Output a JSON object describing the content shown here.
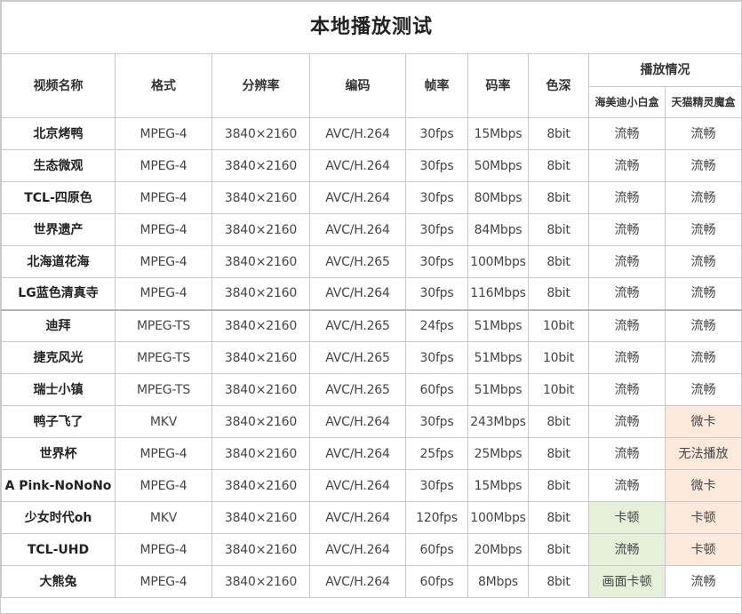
{
  "title": "本地播放测试",
  "headers": {
    "name": "视频名称",
    "format": "格式",
    "resolution": "分辨率",
    "codec": "编码",
    "fps": "帧率",
    "bitrate": "码率",
    "depth": "色深",
    "playback": "播放情况",
    "device1": "海美迪小白盒",
    "device2": "天猫精灵魔盒"
  },
  "colors": {
    "pink_highlight": "#fde9dc",
    "green_highlight": "#e6efd9",
    "border": "#c9c9c9"
  },
  "rows": [
    {
      "name": "北京烤鸭",
      "format": "MPEG-4",
      "resolution": "3840×2160",
      "codec": "AVC/H.264",
      "fps": "30fps",
      "bitrate": "15Mbps",
      "depth": "8bit",
      "device1": "流畅",
      "device2": "流畅"
    },
    {
      "name": "生态微观",
      "format": "MPEG-4",
      "resolution": "3840×2160",
      "codec": "AVC/H.264",
      "fps": "30fps",
      "bitrate": "50Mbps",
      "depth": "8bit",
      "device1": "流畅",
      "device2": "流畅"
    },
    {
      "name": "TCL-四原色",
      "format": "MPEG-4",
      "resolution": "3840×2160",
      "codec": "AVC/H.264",
      "fps": "30fps",
      "bitrate": "80Mbps",
      "depth": "8bit",
      "device1": "流畅",
      "device2": "流畅"
    },
    {
      "name": "世界遗产",
      "format": "MPEG-4",
      "resolution": "3840×2160",
      "codec": "AVC/H.264",
      "fps": "30fps",
      "bitrate": "84Mbps",
      "depth": "8bit",
      "device1": "流畅",
      "device2": "流畅"
    },
    {
      "name": "北海道花海",
      "format": "MPEG-4",
      "resolution": "3840×2160",
      "codec": "AVC/H.265",
      "fps": "30fps",
      "bitrate": "100Mbps",
      "depth": "8bit",
      "device1": "流畅",
      "device2": "流畅"
    },
    {
      "name": "LG蓝色清真寺",
      "format": "MPEG-4",
      "resolution": "3840×2160",
      "codec": "AVC/H.264",
      "fps": "30fps",
      "bitrate": "116Mbps",
      "depth": "8bit",
      "device1": "流畅",
      "device2": "流畅"
    },
    {
      "name": "迪拜",
      "format": "MPEG-TS",
      "resolution": "3840×2160",
      "codec": "AVC/H.265",
      "fps": "24fps",
      "bitrate": "51Mbps",
      "depth": "10bit",
      "device1": "流畅",
      "device2": "流畅"
    },
    {
      "name": "捷克风光",
      "format": "MPEG-TS",
      "resolution": "3840×2160",
      "codec": "AVC/H.265",
      "fps": "30fps",
      "bitrate": "51Mbps",
      "depth": "10bit",
      "device1": "流畅",
      "device2": "流畅"
    },
    {
      "name": "瑞士小镇",
      "format": "MPEG-TS",
      "resolution": "3840×2160",
      "codec": "AVC/H.265",
      "fps": "60fps",
      "bitrate": "51Mbps",
      "depth": "10bit",
      "device1": "流畅",
      "device2": "流畅"
    },
    {
      "name": "鸭子飞了",
      "format": "MKV",
      "resolution": "3840×2160",
      "codec": "AVC/H.264",
      "fps": "30fps",
      "bitrate": "243Mbps",
      "depth": "8bit",
      "device1": "流畅",
      "device2": "微卡"
    },
    {
      "name": "世界杯",
      "format": "MPEG-4",
      "resolution": "3840×2160",
      "codec": "AVC/H.264",
      "fps": "25fps",
      "bitrate": "25Mbps",
      "depth": "8bit",
      "device1": "流畅",
      "device2": "无法播放"
    },
    {
      "name": "A Pink-NoNoNo",
      "format": "MPEG-4",
      "resolution": "3840×2160",
      "codec": "AVC/H.264",
      "fps": "30fps",
      "bitrate": "15Mbps",
      "depth": "8bit",
      "device1": "流畅",
      "device2": "微卡"
    },
    {
      "name": "少女时代oh",
      "format": "MKV",
      "resolution": "3840×2160",
      "codec": "AVC/H.264",
      "fps": "120fps",
      "bitrate": "100Mbps",
      "depth": "8bit",
      "device1": "卡顿",
      "device2": "卡顿"
    },
    {
      "name": "TCL-UHD",
      "format": "MPEG-4",
      "resolution": "3840×2160",
      "codec": "AVC/H.264",
      "fps": "60fps",
      "bitrate": "20Mbps",
      "depth": "8bit",
      "device1": "流畅",
      "device2": "卡顿"
    },
    {
      "name": "大熊兔",
      "format": "MPEG-4",
      "resolution": "3840×2160",
      "codec": "AVC/H.264",
      "fps": "60fps",
      "bitrate": "8Mbps",
      "depth": "8bit",
      "device1": "画面卡顿",
      "device2": "流畅"
    }
  ]
}
